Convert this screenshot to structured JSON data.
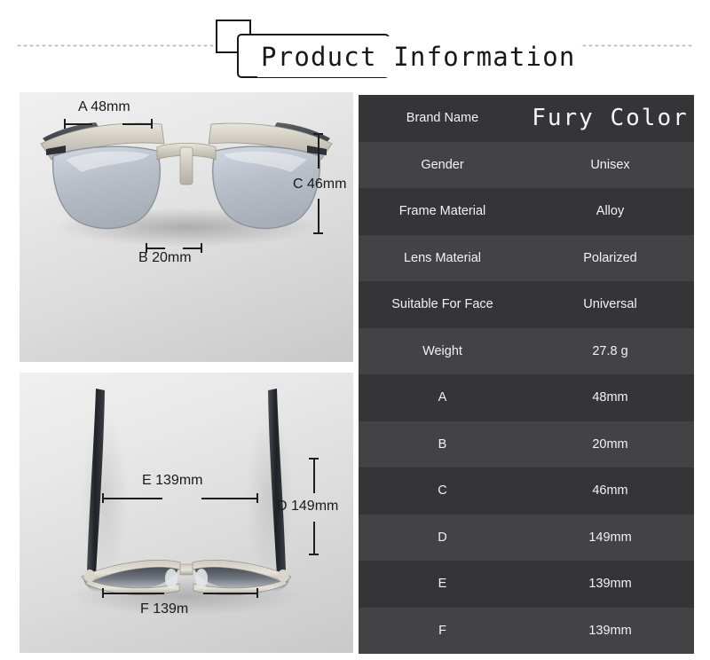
{
  "header": {
    "title": "Product Information"
  },
  "product_views": {
    "front": {
      "name": "sunglasses-front-view",
      "annotations": [
        {
          "id": "A",
          "label": "A 48mm",
          "orientation": "horizontal"
        },
        {
          "id": "B",
          "label": "B 20mm",
          "orientation": "horizontal"
        },
        {
          "id": "C",
          "label": "C 46mm",
          "orientation": "vertical"
        }
      ]
    },
    "top": {
      "name": "sunglasses-top-view",
      "annotations": [
        {
          "id": "E",
          "label": "E 139mm",
          "orientation": "horizontal"
        },
        {
          "id": "F",
          "label": "F 139m",
          "orientation": "horizontal"
        },
        {
          "id": "D",
          "label": "D 149mm",
          "orientation": "vertical"
        }
      ]
    }
  },
  "spec_table": {
    "rows": [
      {
        "key": "Brand Name",
        "value": "Fury Color",
        "style": "brand"
      },
      {
        "key": "Gender",
        "value": "Unisex"
      },
      {
        "key": "Frame Material",
        "value": "Alloy"
      },
      {
        "key": "Lens Material",
        "value": "Polarized"
      },
      {
        "key": "Suitable For Face",
        "value": "Universal"
      },
      {
        "key": "Weight",
        "value": "27.8 g"
      },
      {
        "key": "A",
        "value": "48mm"
      },
      {
        "key": "B",
        "value": "20mm"
      },
      {
        "key": "C",
        "value": "46mm"
      },
      {
        "key": "D",
        "value": "149mm"
      },
      {
        "key": "E",
        "value": "139mm"
      },
      {
        "key": "F",
        "value": "139mm"
      }
    ]
  },
  "colors": {
    "row_dark": "#353537",
    "row_light": "#434345",
    "text_light": "#f2f2f2",
    "ink": "#16181a",
    "panel_bg_top": "#f0f0f0",
    "panel_bg_bottom": "#c9c9c9"
  }
}
